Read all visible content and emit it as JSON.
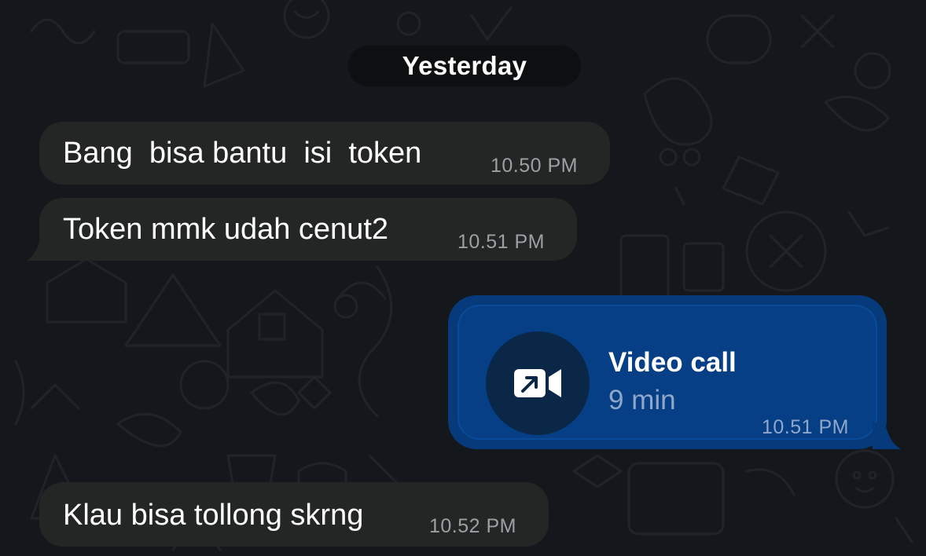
{
  "chat": {
    "date_separator": "Yesterday",
    "messages": [
      {
        "text": "Bang  bisa bantu  isi  token",
        "time": "10.50 PM",
        "direction": "incoming"
      },
      {
        "text": "Token mmk udah cenut2",
        "time": "10.51 PM",
        "direction": "incoming"
      },
      {
        "text": "Klau bisa tollong skrng",
        "time": "10.52 PM",
        "direction": "incoming"
      }
    ],
    "call": {
      "title": "Video call",
      "duration": "9 min",
      "time": "10.51 PM",
      "icon": "outgoing-video-call-icon",
      "direction": "outgoing"
    }
  },
  "colors": {
    "background": "#14171b",
    "incoming_bubble": "#242626",
    "outgoing_bubble": "#063a7a",
    "text": "#ffffff",
    "timestamp": "#9aa0a3"
  }
}
